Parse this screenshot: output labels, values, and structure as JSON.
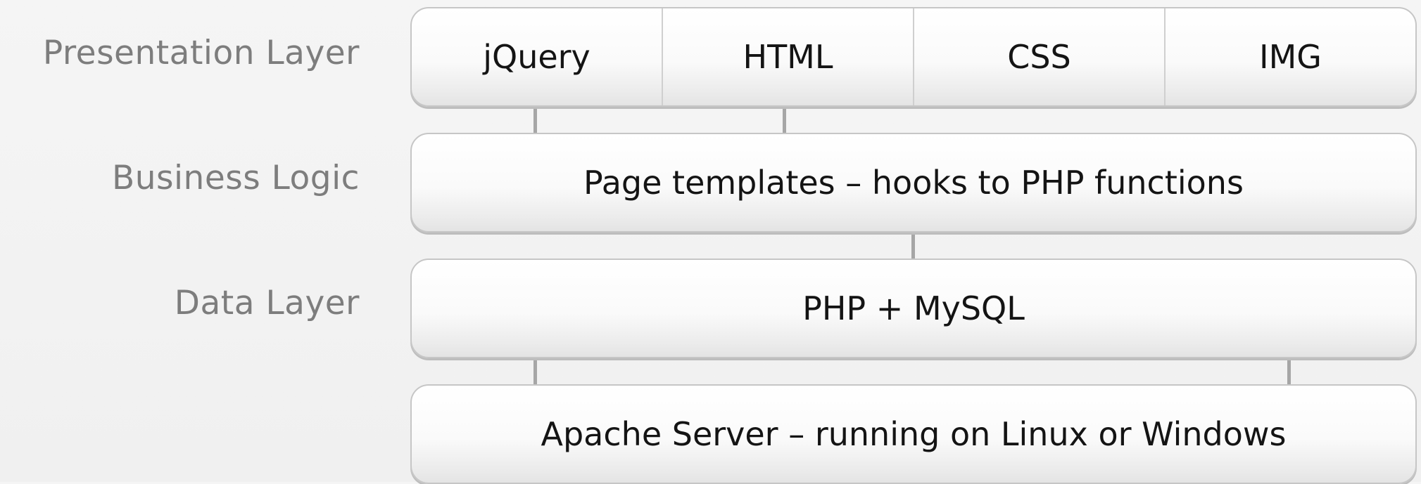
{
  "labels": {
    "presentation": "Presentation Layer",
    "business": "Business Logic",
    "data": "Data Layer"
  },
  "presentation_items": [
    "jQuery",
    "HTML",
    "CSS",
    "IMG"
  ],
  "business_box": "Page templates – hooks to PHP functions",
  "data_box": "PHP + MySQL",
  "server_box": "Apache Server – running on Linux or Windows",
  "colors": {
    "label_text": "#7d7d7d",
    "box_text": "#141414",
    "box_border": "#c6c6c6",
    "connector": "#a6a6a6",
    "background": "#f3f3f3"
  }
}
